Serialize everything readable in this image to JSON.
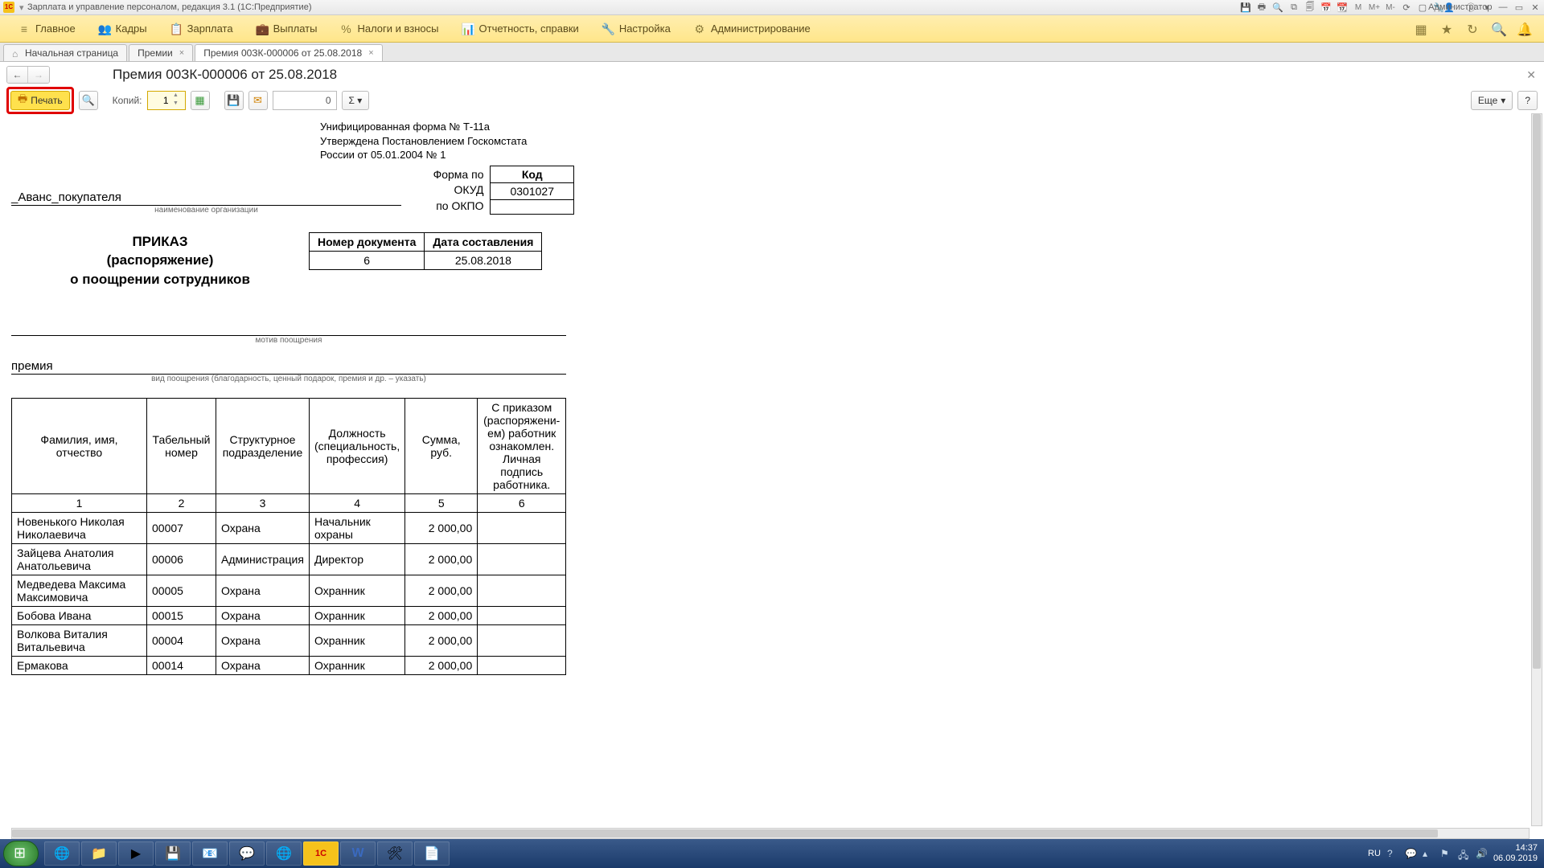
{
  "titlebar": {
    "logo": "1С",
    "title": "Зарплата и управление персоналом, редакция 3.1  (1С:Предприятие)",
    "admin": "Администратор",
    "icons": [
      "save",
      "print",
      "preview",
      "calc",
      "cal1",
      "cal2",
      "clock",
      "M",
      "M+",
      "M-",
      "loop",
      "sq",
      "key"
    ]
  },
  "menu": {
    "items": [
      {
        "icon": "≡",
        "label": "Главное"
      },
      {
        "icon": "👥",
        "label": "Кадры"
      },
      {
        "icon": "📋",
        "label": "Зарплата"
      },
      {
        "icon": "💼",
        "label": "Выплаты"
      },
      {
        "icon": "%",
        "label": "Налоги и взносы"
      },
      {
        "icon": "📊",
        "label": "Отчетность, справки"
      },
      {
        "icon": "🔧",
        "label": "Настройка"
      },
      {
        "icon": "⚙",
        "label": "Администрирование"
      }
    ],
    "right_icons": [
      "apps",
      "star",
      "history",
      "search",
      "bell"
    ]
  },
  "tabs": {
    "items": [
      {
        "label": "Начальная страница",
        "home": true
      },
      {
        "label": "Премии",
        "close": true
      },
      {
        "label": "Премия 00ЗК-000006 от 25.08.2018",
        "close": true,
        "active": true
      }
    ]
  },
  "navtitle": "Премия 00ЗК-000006 от 25.08.2018",
  "toolbar": {
    "print": "Печать",
    "copies_label": "Копий:",
    "copies_value": "1",
    "zero": "0",
    "more": "Еще",
    "help": "?"
  },
  "doc": {
    "meta1": "Унифицированная форма № Т-11а",
    "meta2": "Утверждена Постановлением Госкомстата",
    "meta3": "России от 05.01.2004 № 1",
    "okud_label": "Форма по ОКУД",
    "okpo_label": "по ОКПО",
    "code_header": "Код",
    "okud_value": "0301027",
    "okpo_value": "",
    "org": "_Аванс_покупателя",
    "org_cap": "наименование организации",
    "order_title1": "ПРИКАЗ",
    "order_title2": "(распоряжение)",
    "order_title3": "о поощрении сотрудников",
    "numdate_h1": "Номер документа",
    "numdate_h2": "Дата составления",
    "doc_num": "6",
    "doc_date": "25.08.2018",
    "motive_cap": "мотив поощрения",
    "bonus_type": "премия",
    "bonus_cap": "вид поощрения (благодарность, ценный подарок, премия и др. – указать)",
    "headers": [
      "Фамилия, имя, отчество",
      "Табельный номер",
      "Структурное подразделение",
      "Должность (специальность, профессия)",
      "Сумма, руб.",
      "С приказом (распоряжени-ем) работник ознакомлен. Личная подпись работника."
    ],
    "nums": [
      "1",
      "2",
      "3",
      "4",
      "5",
      "6"
    ],
    "rows": [
      {
        "fio": "Новенького Николая Николаевича",
        "tab": "00007",
        "dep": "Охрана",
        "pos": "Начальник охраны",
        "sum": "2 000,00"
      },
      {
        "fio": "Зайцева Анатолия Анатольевича",
        "tab": "00006",
        "dep": "Администрация",
        "pos": "Директор",
        "sum": "2 000,00"
      },
      {
        "fio": "Медведева Максима Максимовича",
        "tab": "00005",
        "dep": "Охрана",
        "pos": "Охранник",
        "sum": "2 000,00"
      },
      {
        "fio": "Бобова Ивана",
        "tab": "00015",
        "dep": "Охрана",
        "pos": "Охранник",
        "sum": "2 000,00"
      },
      {
        "fio": "Волкова Виталия Витальевича",
        "tab": "00004",
        "dep": "Охрана",
        "pos": "Охранник",
        "sum": "2 000,00"
      },
      {
        "fio": "Ермакова",
        "tab": "00014",
        "dep": "Охрана",
        "pos": "Охранник",
        "sum": "2 000,00"
      }
    ]
  },
  "tray": {
    "lang": "RU",
    "time": "14:37",
    "date": "06.09.2019"
  }
}
